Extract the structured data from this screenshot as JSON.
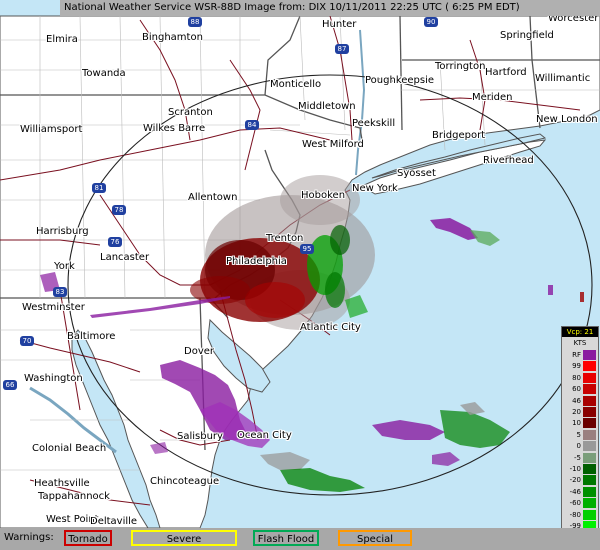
{
  "header": {
    "title": "National Weather Service WSR-88D Image from: DIX 10/11/2011 22:25 UTC ( 6:25 PM EDT)"
  },
  "cities": [
    {
      "name": "Elmira",
      "key": "elmira"
    },
    {
      "name": "Binghamton",
      "key": "binghamton"
    },
    {
      "name": "Hunter",
      "key": "hunter"
    },
    {
      "name": "Worcester",
      "key": "worcester"
    },
    {
      "name": "Springfield",
      "key": "springfield"
    },
    {
      "name": "Towanda",
      "key": "towanda"
    },
    {
      "name": "Monticello",
      "key": "monticello"
    },
    {
      "name": "Poughkeepsie",
      "key": "poughkeepsie"
    },
    {
      "name": "Torrington",
      "key": "torrington"
    },
    {
      "name": "Hartford",
      "key": "hartford"
    },
    {
      "name": "Willimantic",
      "key": "willimantic"
    },
    {
      "name": "Middletown",
      "key": "middletown"
    },
    {
      "name": "Meriden",
      "key": "meriden"
    },
    {
      "name": "Scranton",
      "key": "scranton"
    },
    {
      "name": "Wilkes Barre",
      "key": "wilkes-barre"
    },
    {
      "name": "Peekskill",
      "key": "peekskill"
    },
    {
      "name": "New London",
      "key": "new-london"
    },
    {
      "name": "Williamsport",
      "key": "williamsport"
    },
    {
      "name": "West Milford",
      "key": "west-milford"
    },
    {
      "name": "Bridgeport",
      "key": "bridgeport"
    },
    {
      "name": "Riverhead",
      "key": "riverhead"
    },
    {
      "name": "Syosset",
      "key": "syosset"
    },
    {
      "name": "Allentown",
      "key": "allentown"
    },
    {
      "name": "Hoboken",
      "key": "hoboken"
    },
    {
      "name": "New York",
      "key": "new-york"
    },
    {
      "name": "Harrisburg",
      "key": "harrisburg"
    },
    {
      "name": "Trenton",
      "key": "trenton"
    },
    {
      "name": "Lancaster",
      "key": "lancaster"
    },
    {
      "name": "York",
      "key": "york"
    },
    {
      "name": "Philadelphia",
      "key": "philadelphia"
    },
    {
      "name": "Westminster",
      "key": "westminster"
    },
    {
      "name": "Atlantic City",
      "key": "atlantic-city"
    },
    {
      "name": "Baltimore",
      "key": "baltimore"
    },
    {
      "name": "Dover",
      "key": "dover"
    },
    {
      "name": "Washington",
      "key": "washington"
    },
    {
      "name": "Salisbury",
      "key": "salisbury"
    },
    {
      "name": "Ocean City",
      "key": "ocean-city"
    },
    {
      "name": "Colonial Beach",
      "key": "colonial-beach"
    },
    {
      "name": "Chincoteague",
      "key": "chincoteague"
    },
    {
      "name": "Heathsville",
      "key": "heathsville"
    },
    {
      "name": "Tappahannock",
      "key": "tappahannock"
    },
    {
      "name": "West Point",
      "key": "west-point"
    },
    {
      "name": "Deltaville",
      "key": "deltaville"
    }
  ],
  "highway_shields": [
    "88",
    "90",
    "87",
    "84",
    "81",
    "78",
    "76",
    "95",
    "83",
    "70",
    "66"
  ],
  "legend": {
    "header": "Vcp: 21",
    "unit": "KTS",
    "rows": [
      {
        "label": "RF",
        "color": "#8a1ba0"
      },
      {
        "label": "99",
        "color": "#ff0000"
      },
      {
        "label": "80",
        "color": "#e80000"
      },
      {
        "label": "60",
        "color": "#c80000"
      },
      {
        "label": "46",
        "color": "#a80000"
      },
      {
        "label": "20",
        "color": "#880000"
      },
      {
        "label": "10",
        "color": "#6a0000"
      },
      {
        "label": "5",
        "color": "#9a7f7f"
      },
      {
        "label": "0",
        "color": "#999999"
      },
      {
        "label": "-5",
        "color": "#7a9e7a"
      },
      {
        "label": "-10",
        "color": "#006000"
      },
      {
        "label": "-20",
        "color": "#007800"
      },
      {
        "label": "-46",
        "color": "#009000"
      },
      {
        "label": "-60",
        "color": "#00b000"
      },
      {
        "label": "-80",
        "color": "#00d000"
      },
      {
        "label": "-99",
        "color": "#00f000"
      },
      {
        "label": "ND",
        "color": "#888888"
      }
    ]
  },
  "warnings": {
    "label": "Warnings:",
    "items": [
      {
        "text": "Tornado",
        "color": "#cc0000"
      },
      {
        "text": "Severe Thunderstorm",
        "color": "#ffff00"
      },
      {
        "text": "Flash Flood",
        "color": "#00aa55"
      },
      {
        "text": "Special Marine",
        "color": "#ff9900"
      }
    ]
  },
  "colors": {
    "ocean": "#c4e6f6",
    "land": "#ffffff",
    "border": "#555555",
    "roads": "#7a1020",
    "range_ring": "#222222"
  }
}
